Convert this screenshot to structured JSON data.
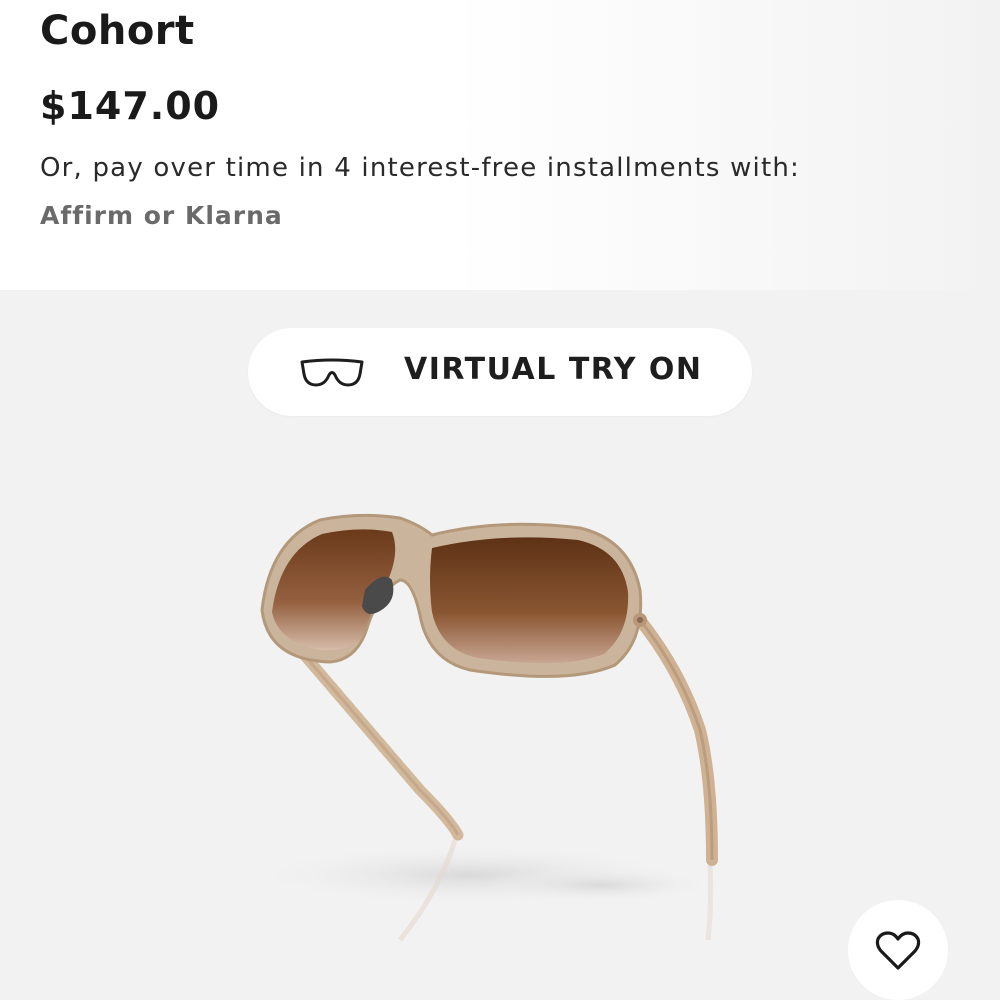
{
  "product": {
    "name": "Cohort",
    "price": "$147.00",
    "installments_text": "Or, pay over time in 4 interest-free installments with:",
    "providers_text": "Affirm or Klarna"
  },
  "gallery": {
    "virtual_try_on": {
      "label": "VIRTUAL TRY ON",
      "icon": "glasses-outline-icon"
    },
    "product_image": "brown-gradient-sunglasses",
    "favorite_icon": "heart-outline-icon"
  },
  "colors": {
    "text_primary": "#1a1a1a",
    "text_secondary": "#6a6a6a",
    "gallery_background": "#f2f2f2",
    "frame": "#c9b29a",
    "lens": "#6b3f1f"
  }
}
